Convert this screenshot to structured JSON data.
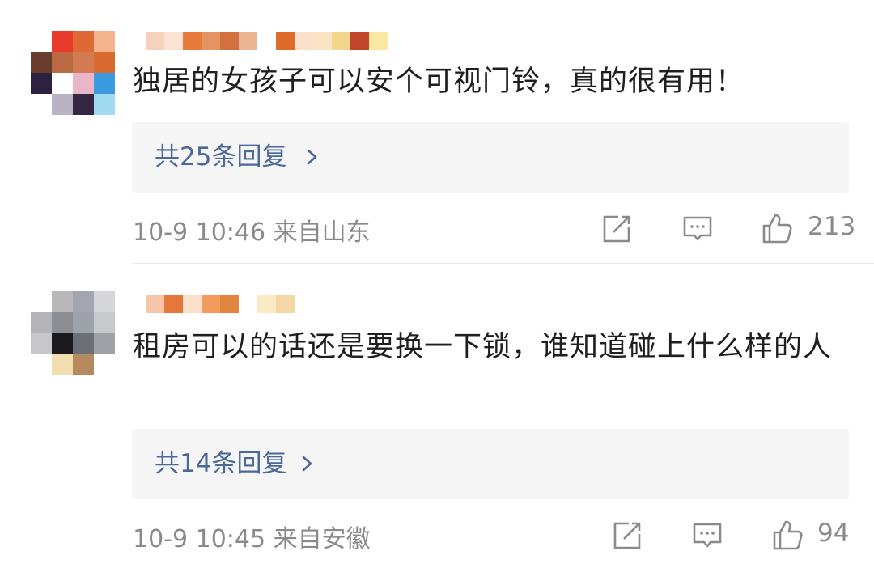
{
  "comments": [
    {
      "text": "独居的女孩子可以安个可视门铃，真的很有用！",
      "reply_label": "共25条回复",
      "meta": "10-9 10:46  来自山东",
      "likes": "213",
      "avatar_colors": [
        "#ffffff",
        "#e83a2b",
        "#dd6a35",
        "#f3b38d",
        "#6a3c2e",
        "#bb6a44",
        "#d27a52",
        "#d96a2e",
        "#2d2140",
        "#ffffff",
        "#e9b6c7",
        "#3b9be0",
        "#ffffff",
        "#b9b3c4",
        "#332744",
        "#9fdaf0"
      ],
      "username_colors": [
        "#f6d2bd",
        "#fbe3d4",
        "#e87a3c",
        "#e69363",
        "#d3703f",
        "#ebb591",
        "#ffffff",
        "#df6b2a",
        "#fbe1cc",
        "#fbe3c5",
        "#f2d48a",
        "#c0452a",
        "#fbe6a3"
      ]
    },
    {
      "text": "租房可以的话还是要换一下锁，谁知道碰上什么样的人",
      "reply_label": "共14条回复",
      "meta": "10-9 10:45  来自安徽",
      "likes": "94",
      "avatar_colors": [
        "#ffffff",
        "#b9b7bb",
        "#a3a6ae",
        "#d6d6da",
        "#b4b4b8",
        "#8d8e94",
        "#9ea3ab",
        "#c8c9cd",
        "#c7c6c8",
        "#1a1a1e",
        "#6c6f76",
        "#9fa1a6",
        "#ffffff",
        "#f1ddb0",
        "#b48a5e",
        "#ffffff"
      ],
      "username_colors": [
        "#f6c7a6",
        "#e5773c",
        "#fbe0cb",
        "#f29b5d",
        "#e2843d",
        "#ffffff",
        "#fbe9c4",
        "#f6d7a3"
      ]
    }
  ]
}
